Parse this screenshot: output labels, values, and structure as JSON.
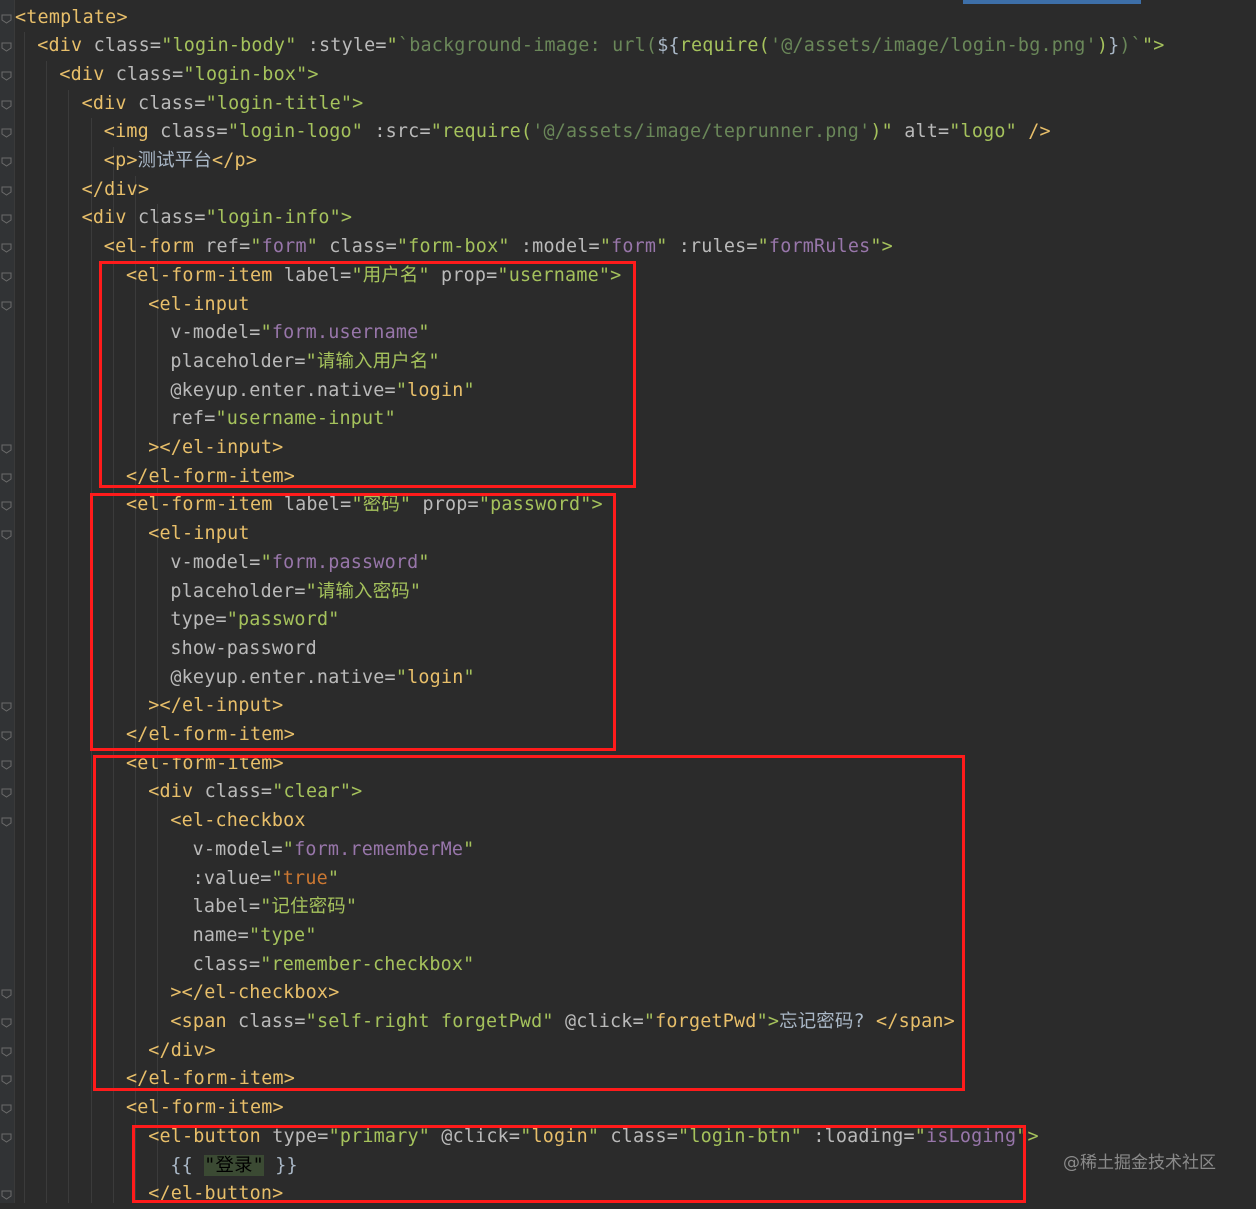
{
  "editor": {
    "lines": [
      [
        [
          "t",
          "<template>"
        ]
      ],
      [
        [
          "t",
          "<div "
        ],
        [
          "a",
          "class="
        ],
        [
          "s",
          "\"login-body\" "
        ],
        [
          "a",
          ":style="
        ],
        [
          "s",
          "\""
        ],
        [
          "z",
          "`background-image: url("
        ],
        [
          "tx",
          "${"
        ],
        [
          "s",
          "require("
        ],
        [
          "z",
          "'@/assets/image/login-bg.png'"
        ],
        [
          "s",
          ")"
        ],
        [
          "tx",
          "}"
        ],
        [
          "z",
          ")`"
        ],
        [
          "s",
          "\">"
        ]
      ],
      [
        [
          "t",
          "<div "
        ],
        [
          "a",
          "class="
        ],
        [
          "s",
          "\"login-box\">"
        ]
      ],
      [
        [
          "t",
          "<div "
        ],
        [
          "a",
          "class="
        ],
        [
          "s",
          "\"login-title\">"
        ]
      ],
      [
        [
          "t",
          "<img "
        ],
        [
          "a",
          "class="
        ],
        [
          "s",
          "\"login-logo\" "
        ],
        [
          "a",
          ":src="
        ],
        [
          "s",
          "\"require("
        ],
        [
          "z",
          "'@/assets/image/teprunner.png'"
        ],
        [
          "s",
          ")\" "
        ],
        [
          "a",
          "alt="
        ],
        [
          "s",
          "\"logo\" "
        ],
        [
          "t",
          "/>"
        ]
      ],
      [
        [
          "t",
          "<p>"
        ],
        [
          "tx",
          "测试平台"
        ],
        [
          "t",
          "</p>"
        ]
      ],
      [
        [
          "t",
          "</div>"
        ]
      ],
      [
        [
          "t",
          "<div "
        ],
        [
          "a",
          "class="
        ],
        [
          "s",
          "\"login-info\">"
        ]
      ],
      [
        [
          "t",
          "<el-form "
        ],
        [
          "a",
          "ref="
        ],
        [
          "s",
          "\""
        ],
        [
          "v",
          "form"
        ],
        [
          "s",
          "\" "
        ],
        [
          "a",
          "class="
        ],
        [
          "s",
          "\"form-box\" "
        ],
        [
          "a",
          ":model="
        ],
        [
          "s",
          "\""
        ],
        [
          "v",
          "form"
        ],
        [
          "s",
          "\" "
        ],
        [
          "a",
          ":rules="
        ],
        [
          "s",
          "\""
        ],
        [
          "v",
          "formRules"
        ],
        [
          "s",
          "\">"
        ]
      ],
      [
        [
          "t",
          "<el-form-item "
        ],
        [
          "a",
          "label="
        ],
        [
          "s",
          "\"用户名\" "
        ],
        [
          "a",
          "prop="
        ],
        [
          "s",
          "\"username\">"
        ]
      ],
      [
        [
          "t",
          "<el-input"
        ]
      ],
      [
        [
          "a",
          "v-model="
        ],
        [
          "s",
          "\""
        ],
        [
          "v",
          "form.username"
        ],
        [
          "s",
          "\""
        ]
      ],
      [
        [
          "a",
          "placeholder="
        ],
        [
          "s",
          "\"请输入用户名\""
        ]
      ],
      [
        [
          "a",
          "@keyup.enter.native="
        ],
        [
          "s",
          "\""
        ],
        [
          "t",
          "login"
        ],
        [
          "s",
          "\""
        ]
      ],
      [
        [
          "a",
          "ref="
        ],
        [
          "s",
          "\"username-input\""
        ]
      ],
      [
        [
          "t",
          "></el-input>"
        ]
      ],
      [
        [
          "t",
          "</el-form-item>"
        ]
      ],
      [
        [
          "t",
          "<el-form-item "
        ],
        [
          "a",
          "label="
        ],
        [
          "s",
          "\"密码\" "
        ],
        [
          "a",
          "prop="
        ],
        [
          "s",
          "\"password\">"
        ]
      ],
      [
        [
          "t",
          "<el-input"
        ]
      ],
      [
        [
          "a",
          "v-model="
        ],
        [
          "s",
          "\""
        ],
        [
          "v",
          "form.password"
        ],
        [
          "s",
          "\""
        ]
      ],
      [
        [
          "a",
          "placeholder="
        ],
        [
          "s",
          "\"请输入密码\""
        ]
      ],
      [
        [
          "a",
          "type="
        ],
        [
          "s",
          "\"password\""
        ]
      ],
      [
        [
          "a",
          "show-password"
        ]
      ],
      [
        [
          "a",
          "@keyup.enter.native="
        ],
        [
          "s",
          "\""
        ],
        [
          "t",
          "login"
        ],
        [
          "s",
          "\""
        ]
      ],
      [
        [
          "t",
          "></el-input>"
        ]
      ],
      [
        [
          "t",
          "</el-form-item>"
        ]
      ],
      [
        [
          "t",
          "<el-form-item>"
        ]
      ],
      [
        [
          "t",
          "<div "
        ],
        [
          "a",
          "class="
        ],
        [
          "s",
          "\"clear\">"
        ]
      ],
      [
        [
          "t",
          "<el-checkbox"
        ]
      ],
      [
        [
          "a",
          "v-model="
        ],
        [
          "s",
          "\""
        ],
        [
          "v",
          "form.rememberMe"
        ],
        [
          "s",
          "\""
        ]
      ],
      [
        [
          "a",
          ":value="
        ],
        [
          "s",
          "\""
        ],
        [
          "k",
          "true"
        ],
        [
          "s",
          "\""
        ]
      ],
      [
        [
          "a",
          "label="
        ],
        [
          "s",
          "\"记住密码\""
        ]
      ],
      [
        [
          "a",
          "name="
        ],
        [
          "s",
          "\"type\""
        ]
      ],
      [
        [
          "a",
          "class="
        ],
        [
          "s",
          "\"remember-checkbox\""
        ]
      ],
      [
        [
          "t",
          "></el-checkbox>"
        ]
      ],
      [
        [
          "t",
          "<span "
        ],
        [
          "a",
          "class="
        ],
        [
          "s",
          "\"self-right forgetPwd\" "
        ],
        [
          "a",
          "@click="
        ],
        [
          "s",
          "\""
        ],
        [
          "t",
          "forgetPwd"
        ],
        [
          "s",
          "\">"
        ],
        [
          "tx",
          "忘记密码? "
        ],
        [
          "t",
          "</span>"
        ]
      ],
      [
        [
          "t",
          "</div>"
        ]
      ],
      [
        [
          "t",
          "</el-form-item>"
        ]
      ],
      [
        [
          "t",
          "<el-form-item>"
        ]
      ],
      [
        [
          "t",
          "<el-button "
        ],
        [
          "a",
          "type="
        ],
        [
          "s",
          "\"primary\" "
        ],
        [
          "a",
          "@click="
        ],
        [
          "s",
          "\""
        ],
        [
          "t",
          "login"
        ],
        [
          "s",
          "\" "
        ],
        [
          "a",
          "class="
        ],
        [
          "s",
          "\"login-btn\" "
        ],
        [
          "a",
          ":loading="
        ],
        [
          "s",
          "\""
        ],
        [
          "v",
          "isLoging"
        ],
        [
          "s",
          "\">"
        ]
      ],
      [
        [
          "tx",
          "{{ "
        ],
        [
          "sb",
          "\"登录\""
        ],
        [
          "tx",
          " }}"
        ]
      ],
      [
        [
          "t",
          "</el-button>"
        ]
      ]
    ]
  },
  "watermark": "@稀土掘金技术社区",
  "colors": {
    "editor_bg": "#2b2b2b",
    "highlight_box": "#ff1b1b",
    "tag": "#e8bf6a",
    "string": "#a5c25c",
    "variable": "#9876aa"
  }
}
